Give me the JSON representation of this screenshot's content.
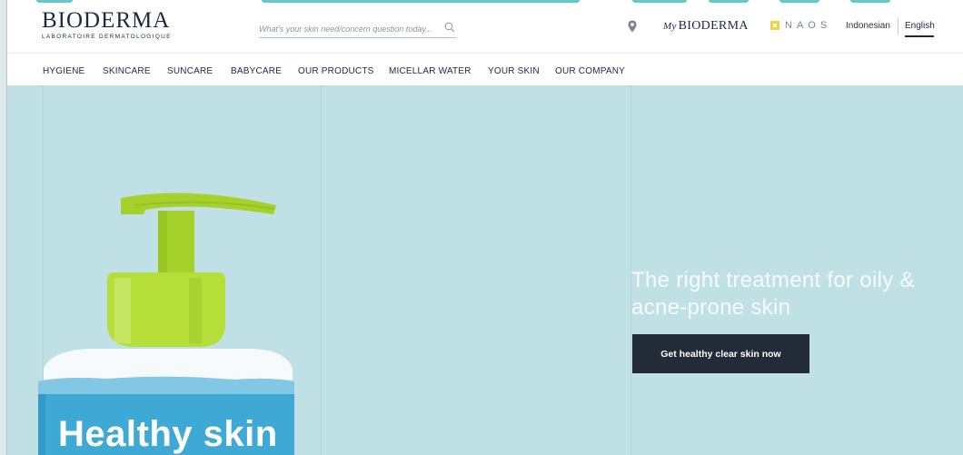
{
  "brand": {
    "name": "BIODERMA",
    "tagline": "LABORATOIRE DERMATOLOGIQUE"
  },
  "search": {
    "placeholder": "What's your skin need/concern question today..."
  },
  "header_links": {
    "my_prefix": "My",
    "my_bioderma": "BIODERMA",
    "naos": "NAOS",
    "lang_id": "Indonesian",
    "lang_en": "English"
  },
  "nav": {
    "items": [
      "HYGIENE",
      "SKINCARE",
      "SUNCARE",
      "BABYCARE",
      "OUR PRODUCTS",
      "MICELLAR WATER",
      "YOUR SKIN",
      "OUR COMPANY"
    ]
  },
  "hero": {
    "title": "The right treatment for oily & acne-prone skin",
    "cta": "Get healthy clear skin now",
    "bottle_text": "Healthy skin"
  },
  "colors": {
    "hero_bg": "#bfe0e4",
    "brand_navy": "#1c2940",
    "cta_bg": "#232b38",
    "pump_green": "#a6d12a",
    "liquid_blue": "#3fa9d6",
    "naos_yellow": "#f3d23a"
  },
  "icons": {
    "search": "search-icon",
    "location": "location-pin-icon",
    "naos": "naos-logo-icon"
  }
}
